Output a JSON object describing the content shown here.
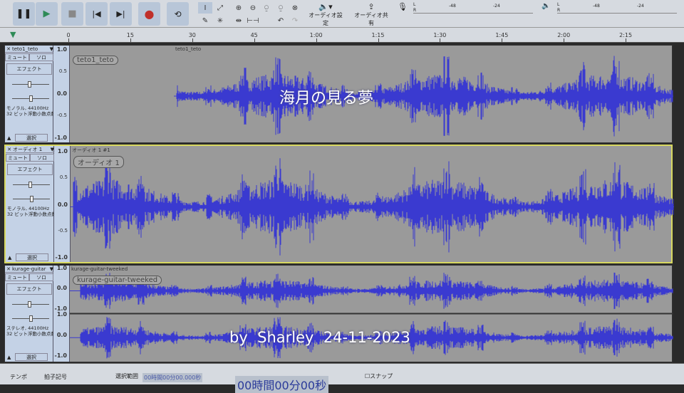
{
  "toolbar": {
    "transport": [
      "pause",
      "play",
      "stop",
      "skip-start",
      "skip-end",
      "record",
      "loop"
    ],
    "audio_settings": "オーディオ設定",
    "share_audio": "オーディオ共有",
    "meter_ticks": [
      "-48",
      "-24"
    ],
    "meter_lr": [
      "L",
      "R"
    ]
  },
  "ruler": {
    "ticks": [
      "0",
      "15",
      "30",
      "45",
      "1:00",
      "1:15",
      "1:30",
      "1:45",
      "2:00",
      "2:15"
    ]
  },
  "tracks": [
    {
      "name": "teto1_teto",
      "clip_name": "teto1_teto",
      "clip_title": "teto1_teto",
      "mute": "ミュート",
      "solo": "ソロ",
      "effect": "エフェクト",
      "format": "モノラル, 44100Hz",
      "bits": "32 ビット浮動小数点数",
      "select": "選択",
      "scale": [
        "1.0",
        "0.5",
        "0.0",
        "-0.5",
        "-1.0"
      ]
    },
    {
      "name": "オーディオ 1",
      "clip_name": "オーディオ 1",
      "clip_title": "オーディオ 1 #1",
      "mute": "ミュート",
      "solo": "ソロ",
      "effect": "エフェクト",
      "format": "モノラル, 44100Hz",
      "bits": "32 ビット浮動小数点数",
      "select": "選択",
      "scale": [
        "1.0",
        "0.5",
        "0.0",
        "-0.5",
        "-1.0"
      ]
    },
    {
      "name": "kurage-guitar",
      "clip_name": "kurage-guitar-tweeked",
      "clip_title": "kurage-guitar-tweeked",
      "mute": "ミュート",
      "solo": "ソロ",
      "effect": "エフェクト",
      "format": "ステレオ, 44100Hz",
      "bits": "32 ビット浮動小数点数",
      "select": "選択",
      "scale": [
        "1.0",
        "0.0",
        "-1.0",
        "1.0",
        "0.0",
        "-1.0"
      ]
    }
  ],
  "bottom": {
    "tempo": "テンポ",
    "time_signature": "拍子記号",
    "selection": "選択範囲",
    "selection_value": "00時間00分00.000秒",
    "time_display": "00時間00分00秒",
    "snap": "スナップ"
  },
  "overlay": {
    "title": "海月の見る夢",
    "credit": "by  Sharley  24-11-2023"
  },
  "colors": {
    "wave": "#3a3ad0",
    "panel": "#c4d2e6",
    "record": "#c0302a",
    "play": "#2e8b57"
  }
}
